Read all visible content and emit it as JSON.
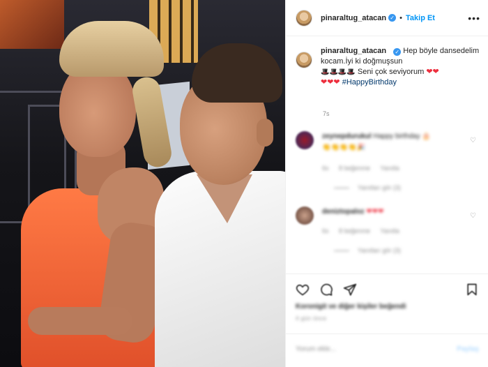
{
  "header": {
    "username": "pinaraltug_atacan",
    "verified_mark": "✓",
    "separator": "•",
    "follow_label": "Takip Et",
    "more_label": "•••"
  },
  "caption": {
    "username": "pinaraltug_atacan",
    "text_1": "Hep böyle dansedelim kocam.İyi ki doğmuşsun",
    "emoji_hats": "🎩🎩🎩🎩",
    "text_2": "Seni çok seviyorum",
    "hearts_inline": "❤❤",
    "hearts_line": "❤❤❤",
    "hashtag": "#HappyBirthday",
    "time": "7s"
  },
  "comments": [
    {
      "username": "zeynepdurukul",
      "text": "Happy birthday 🎂",
      "emojis": "👏👏👏👏🎉",
      "time": "6s",
      "likes": "8 beğenme",
      "reply": "Yanıtla",
      "replies": "Yanıtları gör (3)"
    },
    {
      "username": "deniztopaloz",
      "text": "",
      "emojis": "❤❤❤",
      "time": "6s",
      "likes": "8 beğenme",
      "reply": "Yanıtla",
      "replies": "Yanıtları gör (3)"
    }
  ],
  "actions": {
    "likes": "Koronigit ve diğer kişiler beğendi",
    "posted": "4 gün önce"
  },
  "add_comment": {
    "placeholder": "Yorum ekle...",
    "post_label": "Paylaş"
  },
  "colors": {
    "accent": "#0095f6",
    "verified": "#3897f0",
    "heart": "#ed2f3e",
    "hashtag": "#00376b",
    "muted": "#8e8e8e"
  }
}
